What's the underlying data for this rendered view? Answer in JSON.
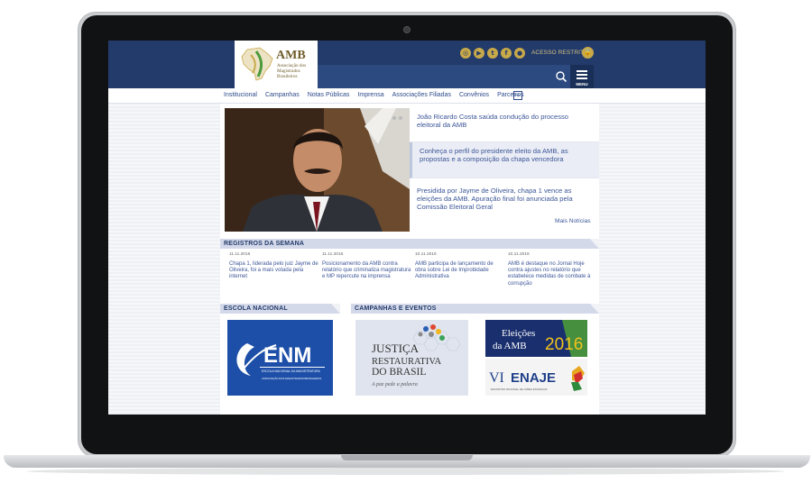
{
  "site": {
    "logo_title": "AMB",
    "logo_subtitle": "Associação dos Magistrados Brasileiros",
    "social_icons": [
      "instagram-icon",
      "youtube-icon",
      "twitter-icon",
      "facebook-icon",
      "flickr-icon"
    ],
    "restricted_label": "ACESSO RESTRITO",
    "menu_label": "MENU",
    "search_placeholder": ""
  },
  "nav": {
    "items": [
      "Institucional",
      "Campanhas",
      "Notas Públicas",
      "Imprensa",
      "Associações Filiadas",
      "Convênios",
      "Parceiros"
    ],
    "more_label": "+"
  },
  "news": {
    "items": [
      "João Ricardo Costa saúda condução do processo eleitoral da AMB",
      "Conheça o perfil do presidente eleito da AMB, as propostas e a composição da chapa vencedora",
      "Presidida por Jayme de Oliveira, chapa 1 vence as eleições da AMB. Apuração final foi anunciada pela Comissão Eleitoral Geral"
    ],
    "more_label": "Mais Notícias"
  },
  "registros": {
    "title": "REGISTROS DA SEMANA",
    "items": [
      {
        "date": "11.11.2016",
        "text": "Chapa 1, liderada pelo juiz Jayme de Oliveira, foi a mais votada pela internet"
      },
      {
        "date": "11.11.2016",
        "text": "Posicionamento da AMB contra relatório que criminaliza magistratura e MP repercute na imprensa"
      },
      {
        "date": "10.11.2016",
        "text": "AMB participa de lançamento de obra sobre Lei de Improbidade Administrativa"
      },
      {
        "date": "10.11.2016",
        "text": "AMB é destaque no Jornal Hoje contra ajustes no relatório que estabelece medidas de combate à corrupção"
      }
    ]
  },
  "escola": {
    "title": "ESCOLA NACIONAL",
    "logo_text": "ENM",
    "logo_sub1": "ESCOLA NACIONAL DA MAGISTRATURA",
    "logo_sub2": "ASSOCIAÇÃO DOS MAGISTRADOS BRASILEIROS"
  },
  "campanhas": {
    "title": "CAMPANHAS E EVENTOS",
    "justica_lines": [
      "JUSTIÇA",
      "RESTAURATIVA",
      "DO BRASIL"
    ],
    "justica_tagline": "A paz pede a palavra",
    "eleicoes_line1": "Eleições",
    "eleicoes_line2": "da AMB",
    "eleicoes_year": "2016",
    "enaje_prefix": "VI",
    "enaje_title": "ENAJE",
    "enaje_sub": "ENCONTRO NACIONAL DE JUÍZES ESTADUAIS"
  },
  "colors": {
    "header": "#233b6a",
    "gold": "#c8a94a",
    "link": "#3c5698",
    "section_bar": "#d4d9ea"
  }
}
